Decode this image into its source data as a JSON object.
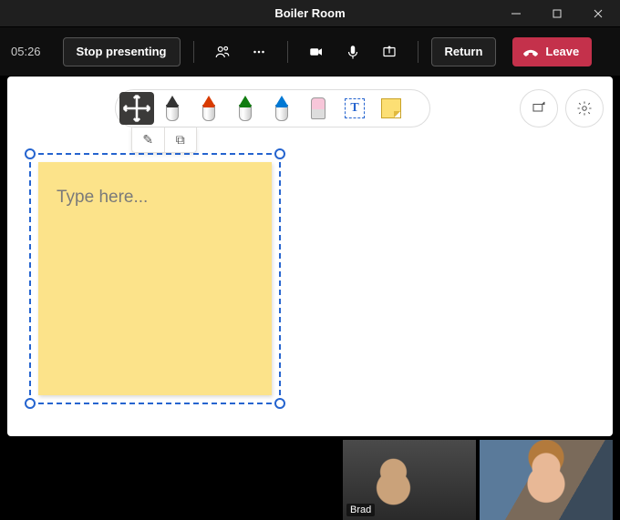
{
  "window": {
    "title": "Boiler Room"
  },
  "call": {
    "timer": "05:26",
    "stop_presenting": "Stop presenting",
    "return": "Return",
    "leave": "Leave"
  },
  "whiteboard": {
    "text_tool_glyph": "T",
    "note_placeholder": "Type here...",
    "sub_pen_glyph": "✎",
    "sub_copy_glyph": "⧉"
  },
  "participants": [
    {
      "name": "Brad"
    },
    {
      "name": ""
    }
  ]
}
